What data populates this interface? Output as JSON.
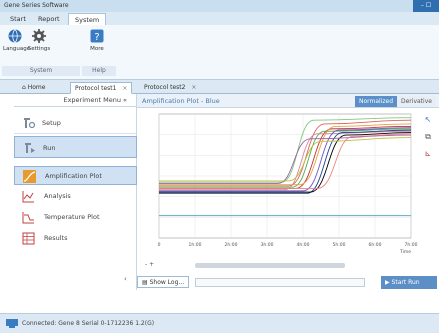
{
  "window": {
    "title": "Gene Series Software",
    "control_label": "–  ☐"
  },
  "menu": {
    "tabs": [
      "Start",
      "Report",
      "System"
    ],
    "active": 2
  },
  "ribbon": {
    "buttons": [
      {
        "label": "Language",
        "icon": "globe-icon"
      },
      {
        "label": "Settings",
        "icon": "gear-icon"
      },
      {
        "label": "More",
        "icon": "help-icon"
      }
    ],
    "groups": [
      "System",
      "Help"
    ]
  },
  "doc_tabs": [
    {
      "label": "Home",
      "icon": "home-icon",
      "close": ""
    },
    {
      "label": "Protocol test1",
      "close": "×"
    },
    {
      "label": "Protocol test2",
      "close": "×"
    }
  ],
  "left_panel": {
    "header": "Experiment Menu",
    "header_arrow": "«",
    "big_items": [
      {
        "label": "Setup",
        "icon": "setup-icon"
      },
      {
        "label": "Run",
        "icon": "run-icon"
      }
    ],
    "small_items": [
      {
        "label": "Amplification Plot",
        "icon": "amplification-icon"
      },
      {
        "label": "Analysis",
        "icon": "analysis-icon"
      },
      {
        "label": "Temperature Plot",
        "icon": "temperature-icon"
      },
      {
        "label": "Results",
        "icon": "results-icon"
      }
    ],
    "collapse_label": "‹"
  },
  "plot_panel": {
    "title": "Amplification Plot - Blue",
    "modes": [
      "Normalized",
      "Derivative"
    ],
    "active_mode": 0,
    "zoom_minus": "- +",
    "show_log": "Show Log...",
    "start_run": "Start Run"
  },
  "chart_data": {
    "type": "line",
    "title": "",
    "xlabel": "Time",
    "ylabel": "",
    "x_ticks": [
      "0",
      "1h:00",
      "2h:00",
      "3h:00",
      "4h:00",
      "5h:00",
      "6h:00",
      "7h:00"
    ],
    "xlim": [
      0,
      7
    ],
    "ylim": [
      0,
      1
    ],
    "grid": true,
    "series": [
      {
        "color": "#e06060",
        "values": [
          [
            0,
            0.42
          ],
          [
            3.6,
            0.42
          ],
          [
            4.6,
            0.92
          ],
          [
            7,
            0.95
          ]
        ]
      },
      {
        "color": "#c03030",
        "values": [
          [
            0,
            0.4
          ],
          [
            3.8,
            0.4
          ],
          [
            4.8,
            0.88
          ],
          [
            7,
            0.9
          ]
        ]
      },
      {
        "color": "#7fc97f",
        "values": [
          [
            0,
            0.45
          ],
          [
            3.4,
            0.45
          ],
          [
            4.3,
            0.95
          ],
          [
            7,
            0.97
          ]
        ]
      },
      {
        "color": "#4caf50",
        "values": [
          [
            0,
            0.41
          ],
          [
            3.7,
            0.41
          ],
          [
            4.6,
            0.86
          ],
          [
            7,
            0.88
          ]
        ]
      },
      {
        "color": "#e8a040",
        "values": [
          [
            0,
            0.43
          ],
          [
            3.9,
            0.43
          ],
          [
            4.9,
            0.9
          ],
          [
            7,
            0.92
          ]
        ]
      },
      {
        "color": "#d48aa0",
        "values": [
          [
            0,
            0.39
          ],
          [
            3.5,
            0.39
          ],
          [
            4.4,
            0.84
          ],
          [
            7,
            0.86
          ]
        ]
      },
      {
        "color": "#6a5acd",
        "values": [
          [
            0,
            0.38
          ],
          [
            4.0,
            0.38
          ],
          [
            5.0,
            0.87
          ],
          [
            7,
            0.89
          ]
        ]
      },
      {
        "color": "#1f3f8f",
        "values": [
          [
            0,
            0.36
          ],
          [
            4.1,
            0.36
          ],
          [
            5.1,
            0.85
          ],
          [
            7,
            0.87
          ]
        ]
      },
      {
        "color": "#000000",
        "values": [
          [
            0,
            0.37
          ],
          [
            4.2,
            0.37
          ],
          [
            5.2,
            0.83
          ],
          [
            7,
            0.85
          ]
        ]
      },
      {
        "color": "#9e5fa8",
        "values": [
          [
            0,
            0.44
          ],
          [
            3.3,
            0.44
          ],
          [
            4.2,
            0.8
          ],
          [
            7,
            0.83
          ]
        ]
      },
      {
        "color": "#bfbf40",
        "values": [
          [
            0,
            0.46
          ],
          [
            3.6,
            0.46
          ],
          [
            4.5,
            0.78
          ],
          [
            7,
            0.81
          ]
        ]
      },
      {
        "color": "#f08080",
        "values": [
          [
            0,
            0.4
          ],
          [
            4.4,
            0.4
          ],
          [
            5.4,
            0.82
          ],
          [
            7,
            0.84
          ]
        ]
      },
      {
        "color": "#40a0c0",
        "values": [
          [
            0,
            0.18
          ],
          [
            7,
            0.18
          ]
        ]
      }
    ]
  },
  "status": {
    "text": "Connected: Gene 8 Serial 0-1712236 1.2(G)"
  },
  "colors": {
    "accent": "#5a8fc8",
    "title_blue": "#4a7cae"
  }
}
